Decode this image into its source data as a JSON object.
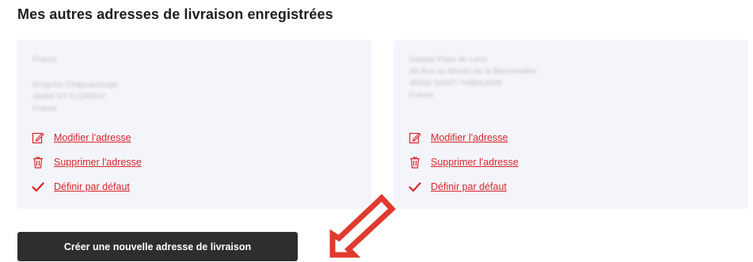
{
  "section": {
    "title": "Mes autres adresses de livraison enregistrées"
  },
  "addresses": [
    {
      "lines": [
        "France",
        "",
        "Grégoire Chapeaurouge",
        "46000 ST FLORENT",
        "France"
      ],
      "actions": {
        "edit": "Modifier l'adresse",
        "delete": "Supprimer l'adresse",
        "default": "Définir par défaut"
      }
    },
    {
      "lines": [
        "Gaspar Papo de Lena",
        "48 Rue du Moulin de la Bienvenidée",
        "46000 SAINT-THIBAUDIN",
        "France"
      ],
      "actions": {
        "edit": "Modifier l'adresse",
        "delete": "Supprimer l'adresse",
        "default": "Définir par défaut"
      }
    }
  ],
  "cta": {
    "label": "Créer une nouvelle adresse de livraison"
  },
  "colors": {
    "accent": "#d9262c",
    "card_bg": "#f4f5fa",
    "button_bg": "#2e2e30"
  },
  "icons": {
    "edit": "pencil-edit-icon",
    "delete": "trash-icon",
    "default": "checkmark-icon",
    "pointer": "arrow-pointer-icon"
  }
}
